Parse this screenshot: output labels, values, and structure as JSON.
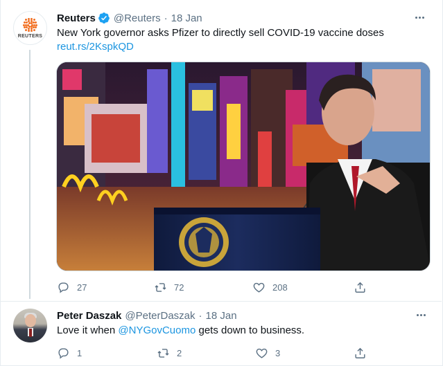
{
  "tweets": [
    {
      "author_name": "Reuters",
      "verified": true,
      "handle": "@Reuters",
      "separator": "·",
      "date": "18 Jan",
      "avatar_text": "REUTERS",
      "text": "New York governor asks Pfizer to directly sell COVID-19 vaccine doses",
      "link": "reut.rs/2KspkQD",
      "media_subject": "Governor at podium in Times Square at night",
      "stats": {
        "replies": "27",
        "retweets": "72",
        "likes": "208"
      }
    },
    {
      "author_name": "Peter Daszak",
      "verified": false,
      "handle": "@PeterDaszak",
      "separator": "·",
      "date": "18 Jan",
      "text_before": "Love it when ",
      "mention": "@NYGovCuomo",
      "text_after": " gets down to business.",
      "stats": {
        "replies": "1",
        "retweets": "2",
        "likes": "3"
      }
    }
  ],
  "colors": {
    "link_blue": "#1b95e0",
    "secondary_text": "#5b7083",
    "primary_text": "#0f1419",
    "reuters_orange": "#f26f21",
    "thread_line": "#cfd9de"
  },
  "icons": [
    "verified-badge-icon",
    "more-icon",
    "reply-icon",
    "retweet-icon",
    "like-icon",
    "share-icon"
  ]
}
